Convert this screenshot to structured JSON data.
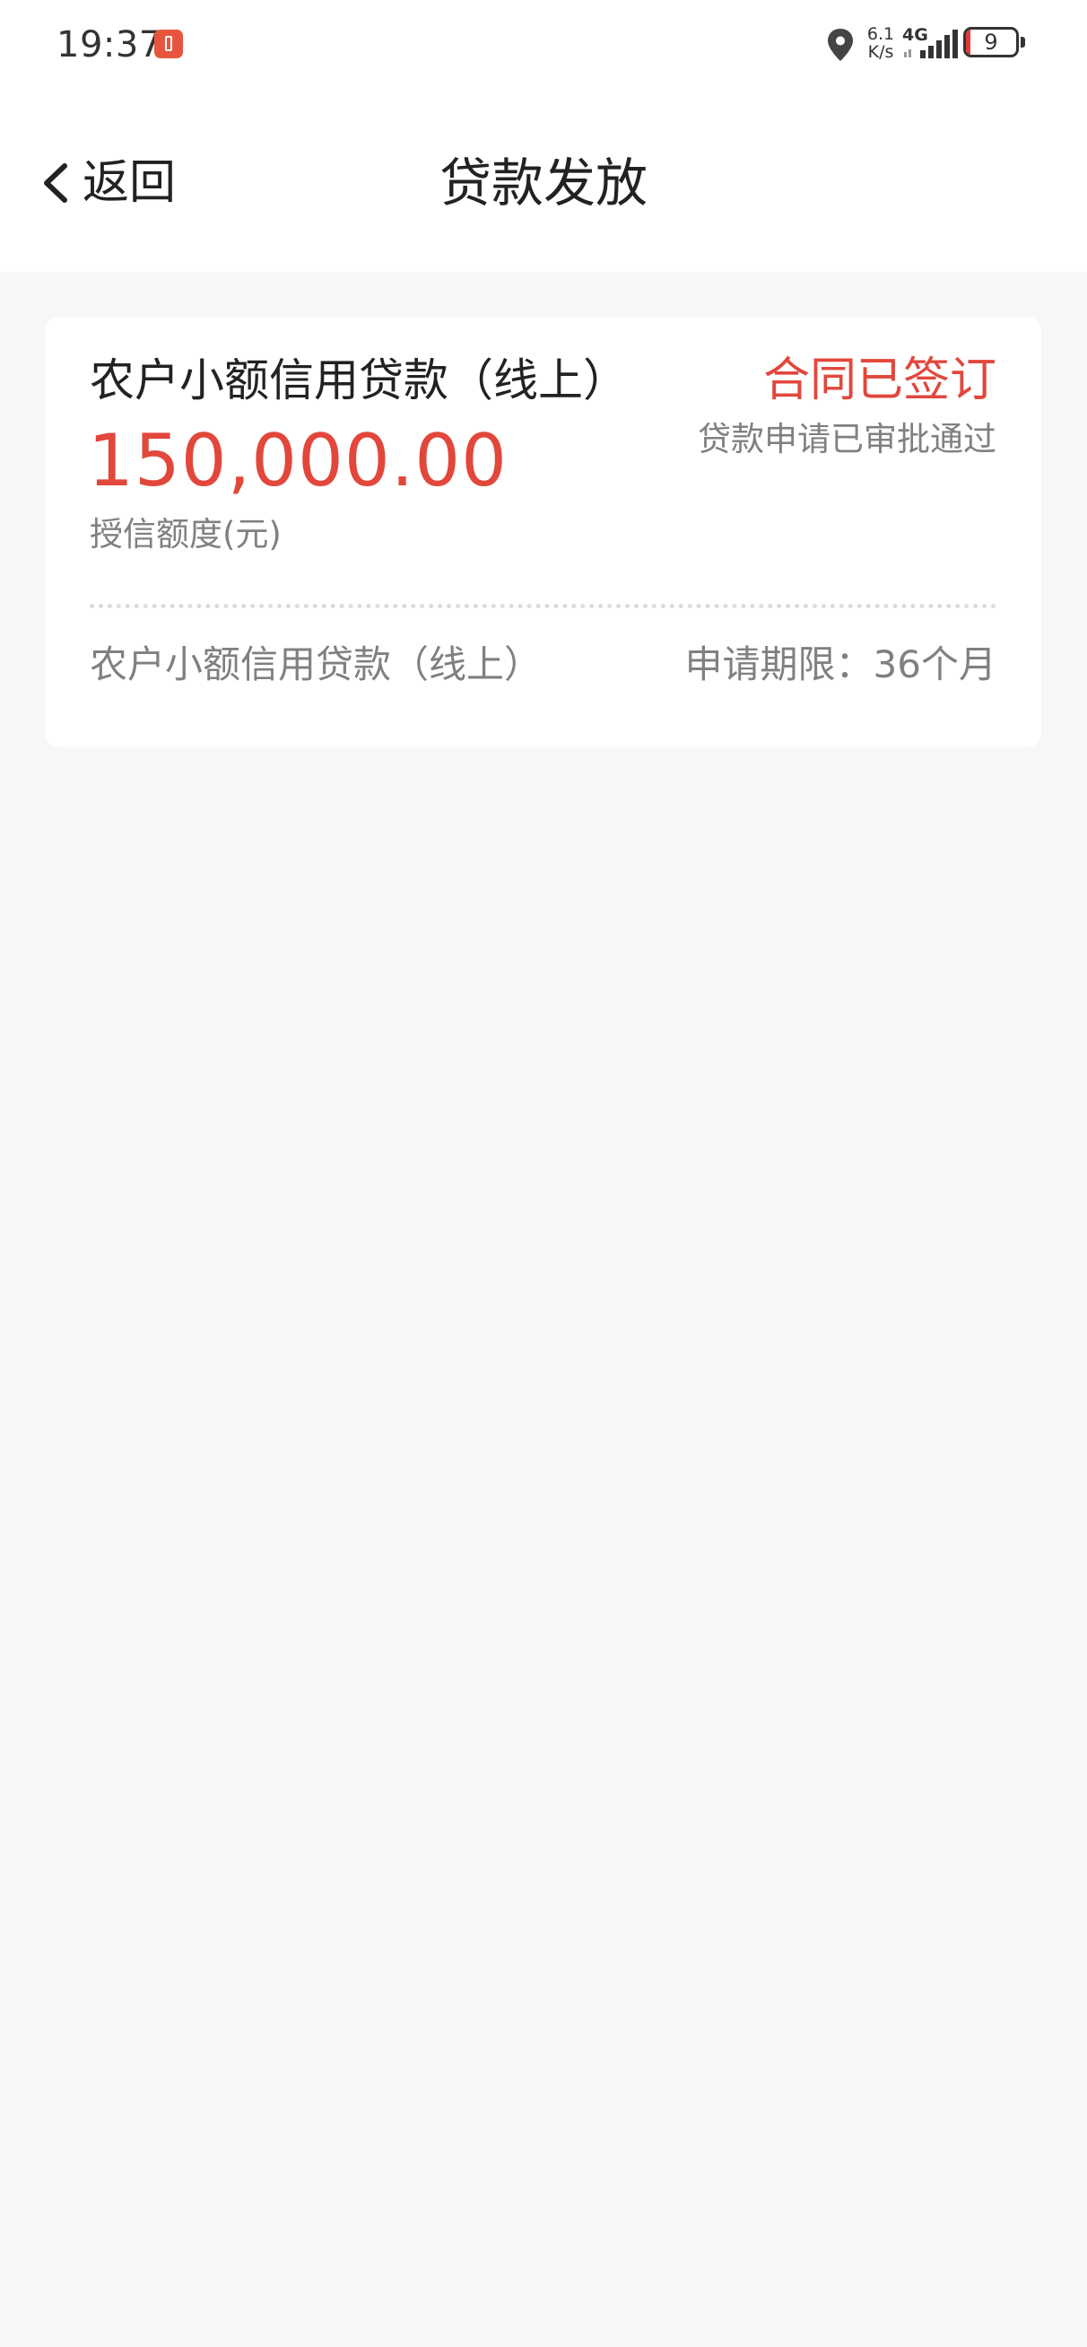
{
  "status_bar": {
    "time": "19:37",
    "net_speed_value": "6.1",
    "net_speed_unit": "K/s",
    "network_type": "4G",
    "battery_level": "9",
    "battery_color": "#e53935",
    "icons": [
      "notification-icon",
      "location-icon",
      "signal-icon",
      "battery-icon"
    ]
  },
  "nav": {
    "back_label": "返回",
    "title": "贷款发放"
  },
  "loan_card": {
    "product_title": "农户小额信用贷款（线上）",
    "contract_status": "合同已签订",
    "approval_status": "贷款申请已审批通过",
    "credit_amount": "150,000.00",
    "credit_label": "授信额度(元)",
    "product_name": "农户小额信用贷款（线上）",
    "term": "申请期限：36个月"
  },
  "colors": {
    "accent_red": "#e2473b",
    "secondary_text": "#808080",
    "background": "#f7f7f7"
  }
}
